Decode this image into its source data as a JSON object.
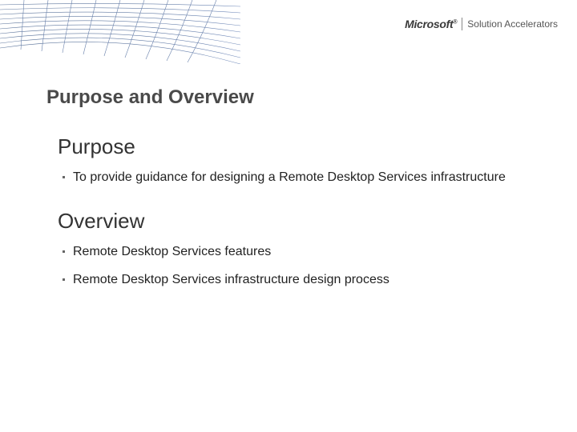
{
  "brand": {
    "company": "Microsoft",
    "product": "Solution Accelerators"
  },
  "slide": {
    "title": "Purpose and Overview",
    "sections": [
      {
        "heading": "Purpose",
        "bullets": [
          "To provide guidance for designing a Remote Desktop Services infrastructure"
        ]
      },
      {
        "heading": "Overview",
        "bullets": [
          "Remote Desktop Services features",
          "Remote Desktop Services infrastructure design process"
        ]
      }
    ]
  }
}
